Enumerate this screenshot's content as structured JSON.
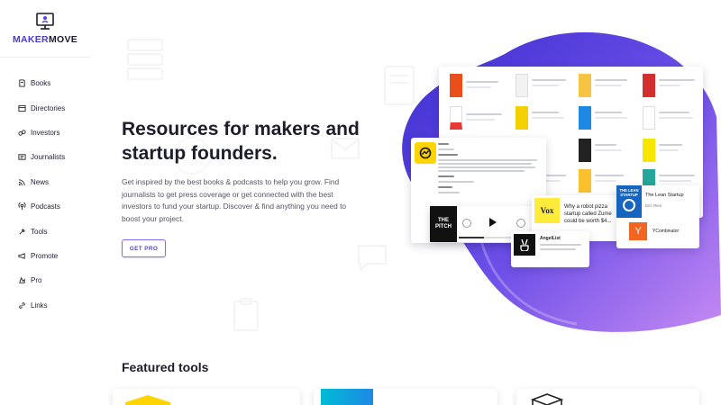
{
  "brand": {
    "name_part1": "MAKER",
    "name_part2": "MOVE"
  },
  "sidebar": {
    "items": [
      {
        "label": "Books",
        "icon": "book-icon"
      },
      {
        "label": "Directories",
        "icon": "directory-icon"
      },
      {
        "label": "Investors",
        "icon": "investor-icon"
      },
      {
        "label": "Journalists",
        "icon": "journalist-icon"
      },
      {
        "label": "News",
        "icon": "rss-icon"
      },
      {
        "label": "Podcasts",
        "icon": "podcast-icon"
      },
      {
        "label": "Tools",
        "icon": "tools-icon"
      },
      {
        "label": "Promote",
        "icon": "megaphone-icon"
      },
      {
        "label": "Pro",
        "icon": "pro-icon"
      },
      {
        "label": "Links",
        "icon": "link-icon"
      }
    ]
  },
  "hero": {
    "title": "Resources for makers and startup founders.",
    "subtitle": "Get inspired by the best books & podcasts to help you grow. Find journalists to get press coverage or get connected with the best investors to fund your startup. Discover & find anything you need to boost your project.",
    "cta": "GET PRO"
  },
  "featured": {
    "title": "Featured tools"
  },
  "showcase": {
    "vox_logo": "Vox",
    "vox_headline": "Why a robot pizza startup called Zume could be worth $4...",
    "pitch_logo": "THE PITCH",
    "lean_cover": "THE LEAN STARTUP",
    "lean_title": "The Lean Startup",
    "lean_author": "Eric Ries",
    "yc_name": "YCombinator",
    "yc_letter": "Y",
    "angel_name": "AngelList"
  },
  "colors": {
    "accent": "#5546e6",
    "blob_start": "#4a3bd6",
    "blob_end": "#c27cf0"
  }
}
